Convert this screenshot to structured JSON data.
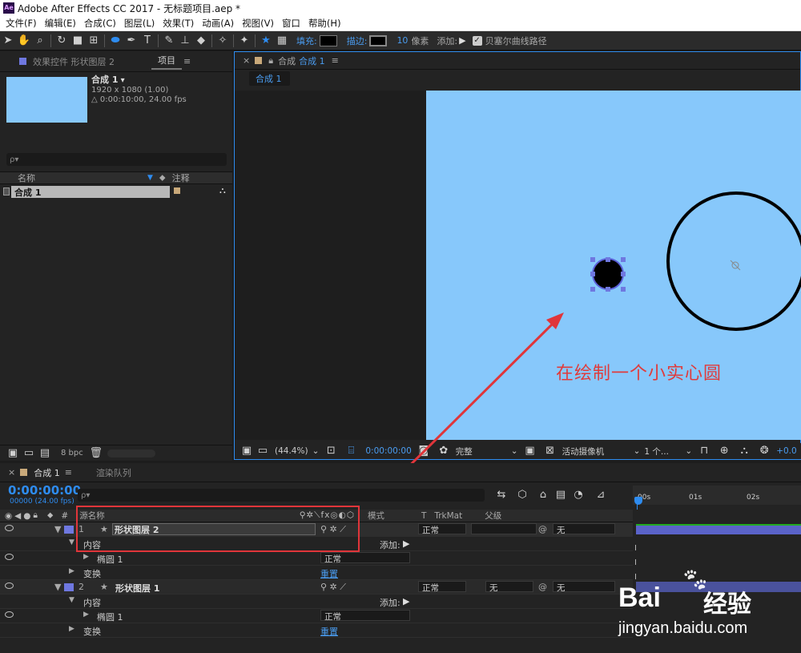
{
  "titlebar": {
    "logo": "Ae",
    "title": "Adobe After Effects CC 2017 - 无标题项目.aep *"
  },
  "menus": [
    "文件(F)",
    "编辑(E)",
    "合成(C)",
    "图层(L)",
    "效果(T)",
    "动画(A)",
    "视图(V)",
    "窗口",
    "帮助(H)"
  ],
  "toolbar": {
    "fill_label": "填充:",
    "stroke_label": "描边:",
    "stroke_width": "10",
    "stroke_unit": "像素",
    "add_label": "添加:",
    "bezier_label": "贝塞尔曲线路径"
  },
  "project": {
    "tab_effects": "效果控件 形状图层 2",
    "tab_project": "项目",
    "comp_name": "合成 1",
    "comp_res": "1920 x 1080 (1.00)",
    "comp_dur": "△ 0:00:10:00, 24.00 fps",
    "search_placeholder": "ρ▾",
    "col_name": "名称",
    "col_comment": "注释",
    "item_name": "合成 1",
    "bpc": "8 bpc"
  },
  "comp_panel": {
    "tab_title": "合成",
    "tab_name": "合成 1",
    "sub_tab": "合成 1",
    "zoom": "(44.4%)",
    "timecode": "0:00:00:00",
    "quality": "完整",
    "camera": "活动摄像机",
    "views": "1 个...",
    "exposure": "+0.0"
  },
  "annotation_text": "在绘制一个小实心圆",
  "timeline": {
    "tab_comp": "合成 1",
    "tab_render": "渲染队列",
    "timecode": "0:00:00:00",
    "fps": "00000 (24.00 fps)",
    "search_placeholder": "ρ▾",
    "col_source": "源名称",
    "col_mode": "模式",
    "col_t": "T",
    "col_trkmat": "TrkMat",
    "col_parent": "父级",
    "ruler_marks": [
      "00s",
      "01s",
      "02s"
    ],
    "layers": [
      {
        "num": "1",
        "name": "形状图层 2",
        "mode": "正常",
        "trkmat": "",
        "parent": "无",
        "content_label": "内容",
        "add_label": "添加:",
        "shape": "椭圆 1",
        "shape_mode": "正常",
        "transform": "变换",
        "reset": "重置"
      },
      {
        "num": "2",
        "name": "形状图层 1",
        "mode": "正常",
        "trkmat": "无",
        "parent": "无",
        "content_label": "内容",
        "add_label": "添加:",
        "shape": "椭圆 1",
        "shape_mode": "正常",
        "transform": "变换",
        "reset": "重置"
      }
    ]
  },
  "watermark": {
    "brand": "Bai",
    "brand2": "经验",
    "url": "jingyan.baidu.com"
  },
  "colors": {
    "accent": "#2e8cf0",
    "canvas": "#87c8fb",
    "annotation": "#e0353a",
    "label_layer": "#6f78e0"
  }
}
